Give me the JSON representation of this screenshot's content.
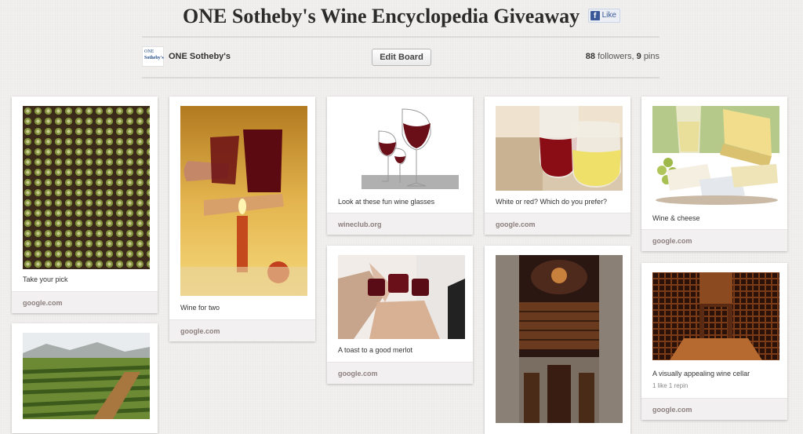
{
  "board": {
    "title": "ONE Sotheby's Wine Encyclopedia Giveaway",
    "like_label": "Like",
    "fb_icon_glyph": "f",
    "owner_name": "ONE Sotheby's",
    "avatar_text_1": "ONE",
    "avatar_text_2": "Sotheby's",
    "edit_button": "Edit Board",
    "followers_count": "88",
    "followers_label": "followers,",
    "pins_count": "9",
    "pins_label": "pins"
  },
  "pins": [
    {
      "desc": "Take your pick",
      "source": "google.com",
      "image": "wine-rack-bottles-image"
    },
    {
      "desc": "Wine for two",
      "source": "google.com",
      "image": "candlelit-toast-image"
    },
    {
      "desc": "Look at these fun wine glasses",
      "source": "wineclub.org",
      "image": "wine-glasses-image"
    },
    {
      "desc": "White or red? Which do you prefer?",
      "source": "google.com",
      "image": "red-white-wine-image"
    },
    {
      "desc": "Wine & cheese",
      "source": "google.com",
      "image": "wine-cheese-image"
    },
    {
      "desc": "A toast to a good merlot",
      "source": "google.com",
      "image": "merlot-toast-image"
    },
    {
      "desc": "A visually appealing wine cellar",
      "source": "google.com",
      "likes": "1 like",
      "repins": "1 repin",
      "image": "wine-cellar-image"
    },
    {
      "desc": "",
      "source": "",
      "image": "vineyard-image"
    },
    {
      "desc": "",
      "source": "",
      "image": "stone-cellar-image"
    }
  ]
}
